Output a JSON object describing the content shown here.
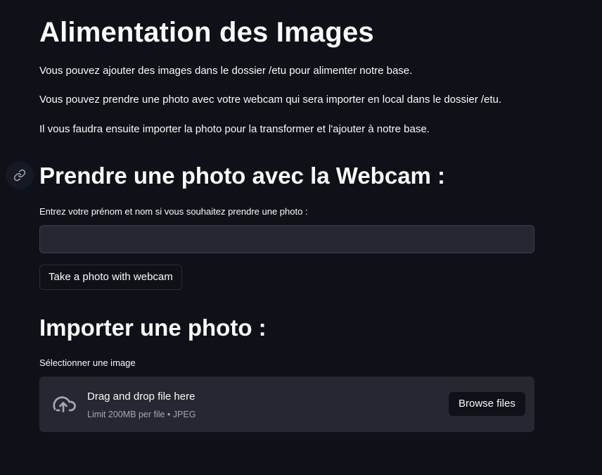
{
  "header": {
    "title": "Alimentation des Images"
  },
  "intro": {
    "p1": "Vous pouvez ajouter des images dans le dossier /etu pour alimenter notre base.",
    "p2": "Vous pouvez prendre une photo avec votre webcam qui sera importer en local dans le dossier /etu.",
    "p3": "Il vous faudra ensuite importer la photo pour la transformer et l'ajouter à notre base."
  },
  "webcam_section": {
    "heading": "Prendre une photo avec la Webcam :",
    "anchor_icon": "link-icon",
    "input_label": "Entrez votre prénom et nom si vous souhaitez prendre une photo :",
    "input_value": "",
    "input_placeholder": "",
    "button_label": "Take a photo with webcam"
  },
  "import_section": {
    "heading": "Importer une photo :",
    "uploader_label": "Sélectionner une image",
    "dropzone_icon": "cloud-upload-icon",
    "dropzone_title": "Drag and drop file here",
    "dropzone_limit": "Limit 200MB per file • JPEG",
    "browse_label": "Browse files"
  },
  "colors": {
    "background": "#0e1117",
    "widget_bg": "#262730",
    "text": "#fafafa",
    "muted_text": "#a3a8b4"
  }
}
